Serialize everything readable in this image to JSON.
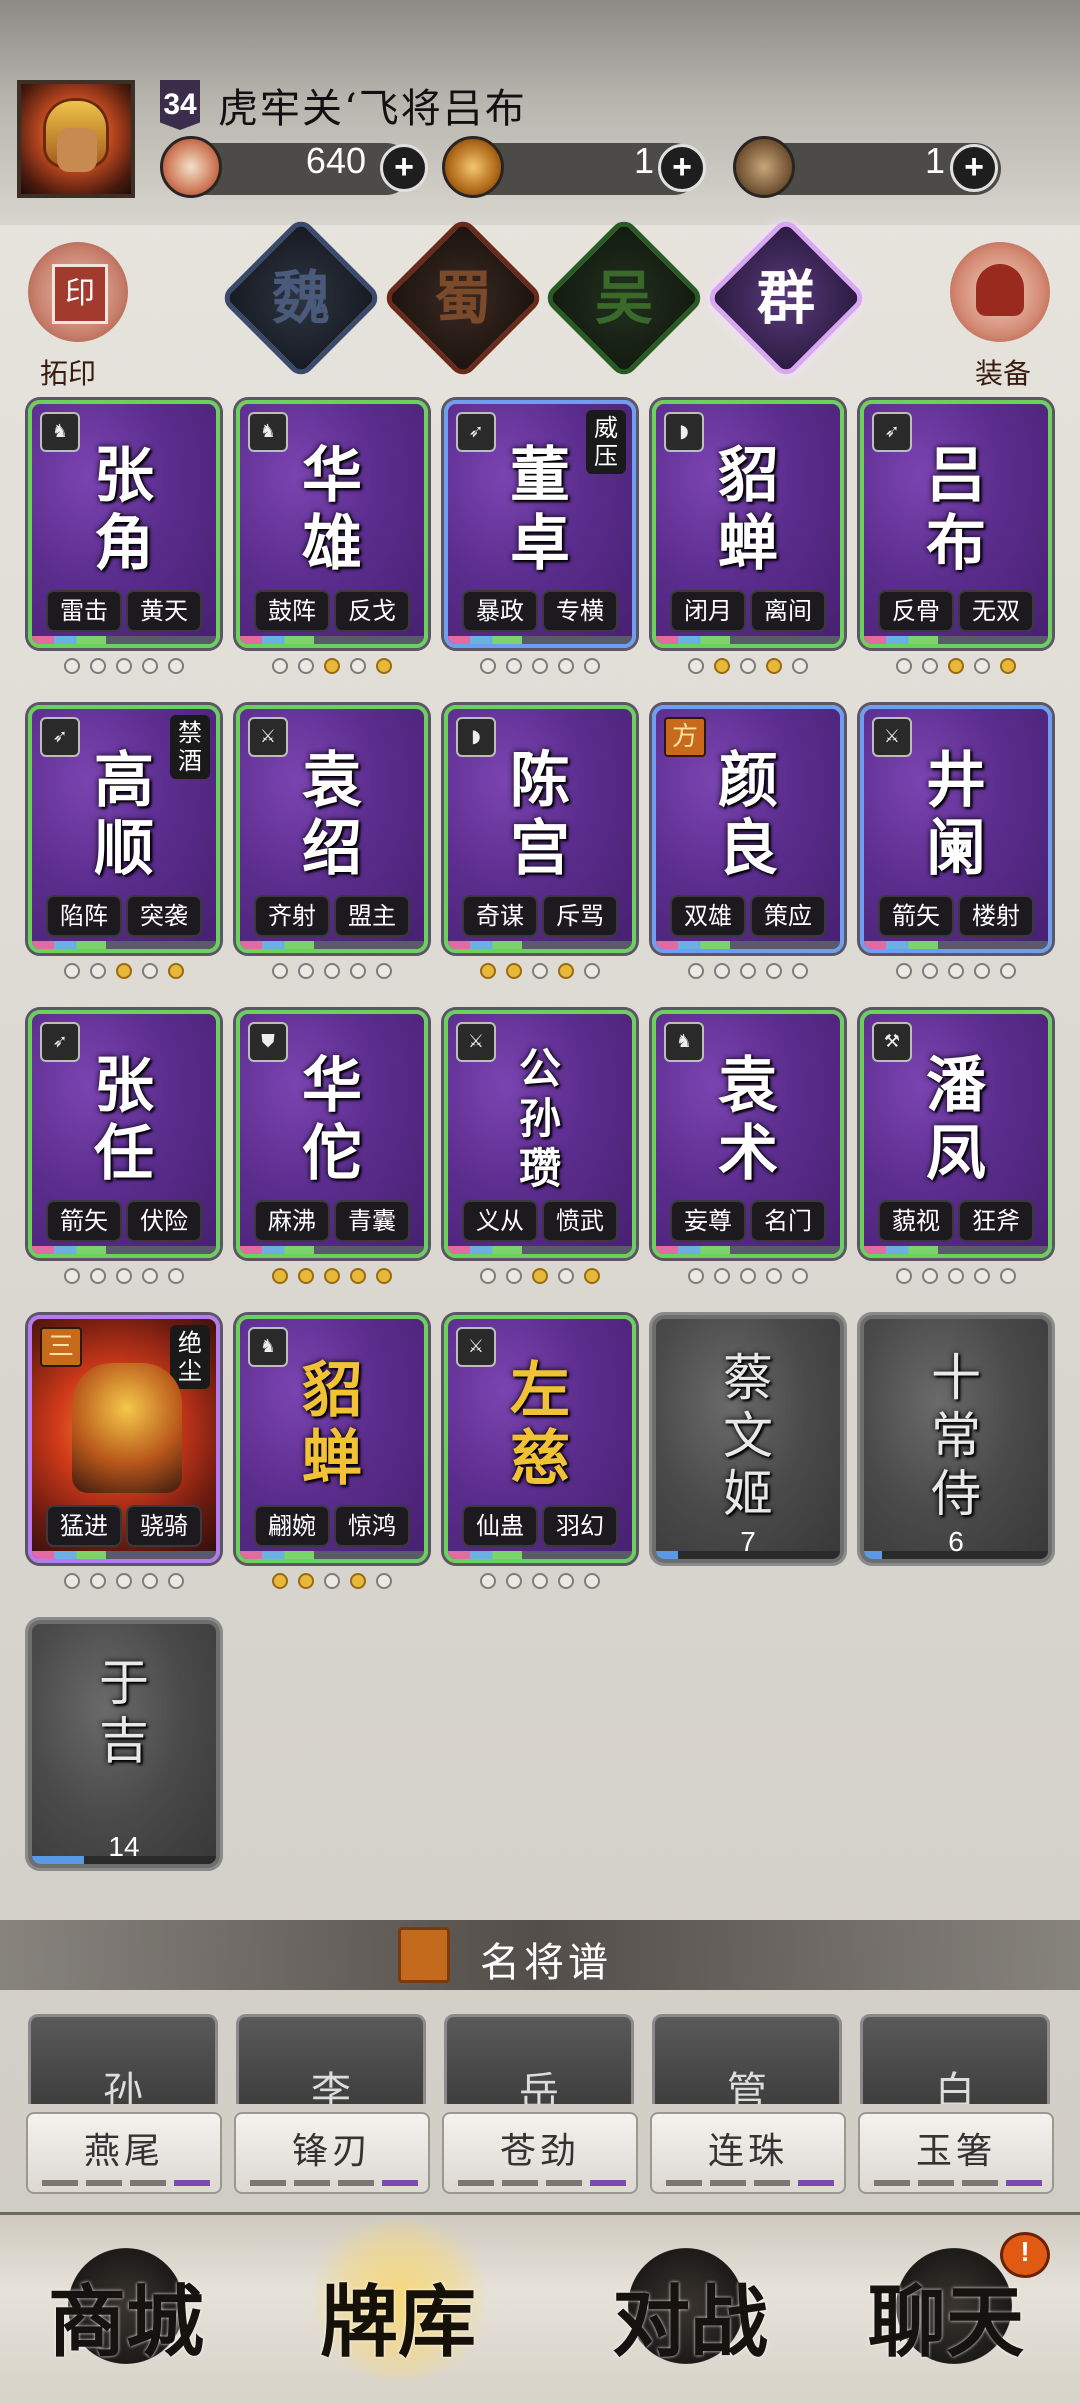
{
  "header": {
    "level": "34",
    "title": "虎牢关‘飞将吕布",
    "resources": [
      {
        "icon": "crossed-swords-icon",
        "value": "640"
      },
      {
        "icon": "scroll-bag-icon",
        "value": "1"
      },
      {
        "icon": "bronze-orb-icon",
        "value": "1"
      }
    ],
    "plus_label": "+"
  },
  "side": {
    "left_label": "拓印",
    "left_seal": "印",
    "right_label": "装备"
  },
  "factions": [
    "魏",
    "蜀",
    "吴",
    "群"
  ],
  "cards": [
    {
      "name": "张\n角",
      "skills": [
        "雷击",
        "黄天"
      ],
      "dots": [
        0,
        0,
        0,
        0,
        0
      ],
      "icon": "horse-icon"
    },
    {
      "name": "华\n雄",
      "skills": [
        "鼓阵",
        "反戈"
      ],
      "dots": [
        0,
        0,
        1,
        0,
        1
      ],
      "icon": "horse-icon"
    },
    {
      "name": "董\n卓",
      "skills": [
        "暴政",
        "专横"
      ],
      "dots": [
        0,
        0,
        0,
        0,
        0
      ],
      "icon": "arrow-icon",
      "badge": "威\n压"
    },
    {
      "name": "貂\n蝉",
      "skills": [
        "闭月",
        "离间"
      ],
      "dots": [
        0,
        1,
        0,
        1,
        0
      ],
      "icon": "fan-icon"
    },
    {
      "name": "吕\n布",
      "skills": [
        "反骨",
        "无双"
      ],
      "dots": [
        0,
        0,
        1,
        0,
        1
      ],
      "icon": "arrow-icon"
    },
    {
      "name": "高\n顺",
      "skills": [
        "陷阵",
        "突袭"
      ],
      "dots": [
        0,
        0,
        1,
        0,
        1
      ],
      "icon": "arrow-icon",
      "badge": "禁\n酒"
    },
    {
      "name": "袁\n绍",
      "skills": [
        "齐射",
        "盟主"
      ],
      "dots": [
        0,
        0,
        0,
        0,
        0
      ],
      "icon": "sword-icon"
    },
    {
      "name": "陈\n宫",
      "skills": [
        "奇谋",
        "斥骂"
      ],
      "dots": [
        1,
        1,
        0,
        1,
        0
      ],
      "icon": "fan-icon"
    },
    {
      "name": "颜\n良",
      "skills": [
        "双雄",
        "策应"
      ],
      "dots": [
        0,
        0,
        0,
        0,
        0
      ],
      "rank": "方"
    },
    {
      "name": "井\n阑",
      "skills": [
        "箭矢",
        "楼射"
      ],
      "dots": [
        0,
        0,
        0,
        0,
        0
      ],
      "icon": "sword-icon"
    },
    {
      "name": "张\n任",
      "skills": [
        "箭矢",
        "伏险"
      ],
      "dots": [
        0,
        0,
        0,
        0,
        0
      ],
      "icon": "arrow-icon"
    },
    {
      "name": "华\n佗",
      "skills": [
        "麻沸",
        "青囊"
      ],
      "dots": [
        1,
        1,
        1,
        1,
        1
      ],
      "icon": "shield-icon"
    },
    {
      "name": "公\n孙\n瓒",
      "skills": [
        "义从",
        "愤武"
      ],
      "dots": [
        0,
        0,
        1,
        0,
        1
      ],
      "icon": "sword-icon"
    },
    {
      "name": "袁\n术",
      "skills": [
        "妄尊",
        "名门"
      ],
      "dots": [
        0,
        0,
        0,
        0,
        0
      ],
      "icon": "horse-icon"
    },
    {
      "name": "潘\n凤",
      "skills": [
        "藐视",
        "狂斧"
      ],
      "dots": [
        0,
        0,
        0,
        0,
        0
      ],
      "icon": "axe-icon"
    },
    {
      "name": "",
      "skills": [
        "猛进",
        "骁骑"
      ],
      "dots": [
        0,
        0,
        0,
        0,
        0
      ],
      "rank": "三",
      "badge": "绝\n尘"
    },
    {
      "name": "貂\n蝉",
      "skills": [
        "翩婉",
        "惊鸿"
      ],
      "dots": [
        1,
        1,
        0,
        1,
        0
      ],
      "icon": "horse-icon"
    },
    {
      "name": "左\n慈",
      "skills": [
        "仙蛊",
        "羽幻"
      ],
      "dots": [
        0,
        0,
        0,
        0,
        0
      ],
      "icon": "sword-icon"
    },
    {
      "name": "蔡\n文\n姬",
      "count": "7",
      "progress": 0.12
    },
    {
      "name": "十\n常\n侍",
      "count": "6",
      "progress": 0.1
    },
    {
      "name": "于\n吉",
      "count": "14",
      "progress": 0.28
    }
  ],
  "section": {
    "title": "名将谱"
  },
  "mini_cards": [
    "孙",
    "李",
    "岳",
    "管",
    "白"
  ],
  "formations": [
    "燕尾",
    "锋刃",
    "苍劲",
    "连珠",
    "玉箸"
  ],
  "nav": {
    "shop": "商城",
    "deck": "牌库",
    "battle": "对战",
    "chat": "聊天",
    "chat_badge": "!"
  }
}
